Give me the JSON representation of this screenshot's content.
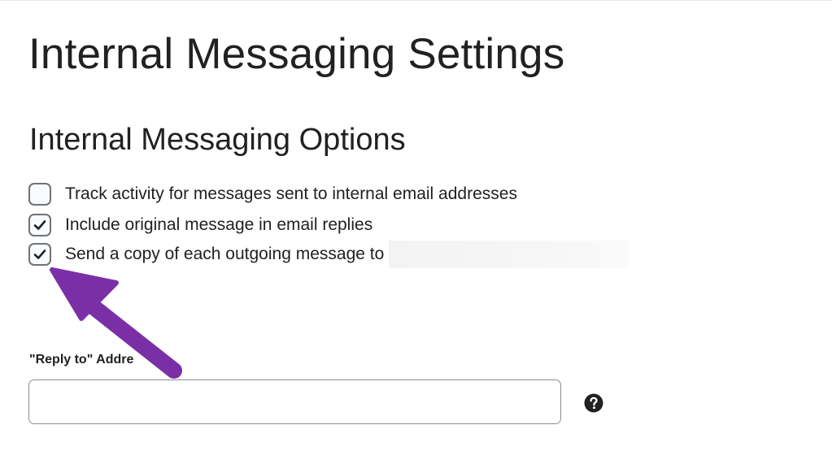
{
  "page": {
    "title": "Internal Messaging Settings"
  },
  "section": {
    "title": "Internal Messaging Options"
  },
  "options": [
    {
      "label": "Track activity for messages sent to internal email addresses",
      "checked": false
    },
    {
      "label": "Include original message in email replies",
      "checked": true
    },
    {
      "label": "Send a copy of each outgoing message to",
      "checked": true
    }
  ],
  "reply_to": {
    "label": "\"Reply to\" Addre",
    "value": "",
    "help_icon": "question-circle-icon"
  },
  "annotation": {
    "icon": "arrow-icon",
    "color": "#7b2fa6"
  },
  "colors": {
    "text": "#202122",
    "checkbox_border": "#6e7376",
    "check_mark": "#202122"
  }
}
